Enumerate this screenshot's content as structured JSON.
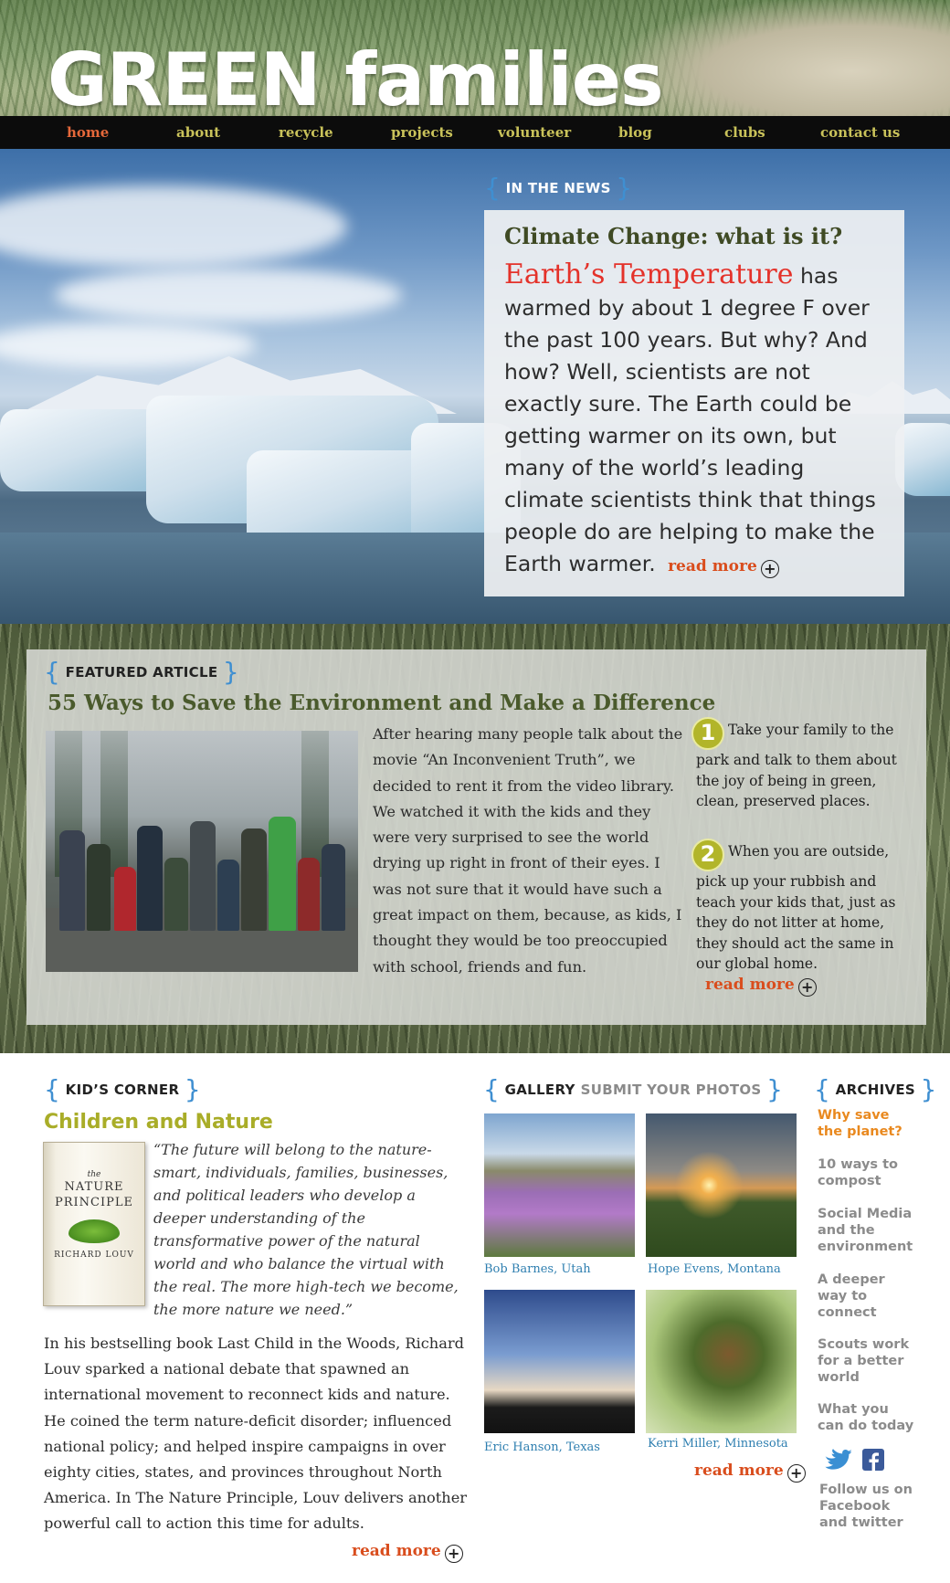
{
  "brand": "GREEN families",
  "nav": [
    "home",
    "about",
    "recycle",
    "projects",
    "volunteer",
    "blog",
    "clubs",
    "contact us"
  ],
  "news": {
    "tag": "IN THE NEWS",
    "title": "Climate Change: what is it?",
    "highlight": "Earth’s Temperature",
    "body": " has warmed by about 1 degree F over the past 100 years. But why? And how? Well, scientists are not exactly sure. The Earth could be getting warmer on its own, but many of the world’s leading climate scientists think that things people do are helping to make the Earth warmer.",
    "read_more": "read more"
  },
  "featured": {
    "tag": "FEATURED ARTICLE",
    "title": "55 Ways to Save the Environment and Make a Difference",
    "text": "After hearing many people talk about the movie “An Inconvenient Truth”, we decided to rent it from the video library. We watched it with the kids and they were very surprised to see the world drying up right in front of their eyes. I was not sure that it would have such a great impact on them, because, as kids, I thought they would be too preoccupied with school, friends and fun.",
    "tips": [
      {
        "num": "1",
        "text": "Take your family to the park and talk to them about the joy of being in green, clean, preserved places."
      },
      {
        "num": "2",
        "text": "When you are outside, pick up your rubbish and teach your kids that, just as they do not litter at home, they should act the same in our global home."
      }
    ],
    "read_more": "read more"
  },
  "kids": {
    "tag": "KID’S CORNER",
    "title": "Children and Nature",
    "book": {
      "line1": "the",
      "line2": "NATURE PRINCIPLE",
      "line3": "RICHARD LOUV"
    },
    "quote": "“The future will belong to the nature-smart, individuals, families, businesses, and political leaders who develop a deeper understanding of the transformative power of the natural world and who balance the virtual with the real. The more high-tech we become, the more nature we need.”",
    "body": "In his bestselling book Last Child in the Woods, Richard Louv sparked a national debate that spawned an international movement to reconnect kids and nature. He coined the term nature-deficit disorder; influenced national policy; and helped inspire campaigns in over eighty cities, states, and provinces throughout North America. In The Nature Principle, Louv delivers another powerful call to action this time for adults.",
    "read_more": "read more"
  },
  "gallery": {
    "tag": "GALLERY",
    "submit": "SUBMIT YOUR PHOTOS",
    "photos": [
      {
        "caption": "Bob Barnes, Utah"
      },
      {
        "caption": "Hope Evens, Montana"
      },
      {
        "caption": "Eric Hanson, Texas"
      },
      {
        "caption": "Kerri Miller, Minnesota"
      }
    ],
    "read_more": "read more"
  },
  "archives": {
    "tag": "ARCHIVES",
    "items": [
      "Why save the planet?",
      "10 ways to compost",
      "Social Media and the environment",
      "A deeper way to connect",
      "Scouts work for a better world",
      "What you can do today"
    ],
    "follow": "Follow us on Facebook and twitter"
  },
  "colors": {
    "accent_red": "#e4322a",
    "nav_yellow": "#c9c25a",
    "bracket_blue": "#3f8fd1",
    "olive": "#a9ad28",
    "orange": "#d94d1d"
  }
}
